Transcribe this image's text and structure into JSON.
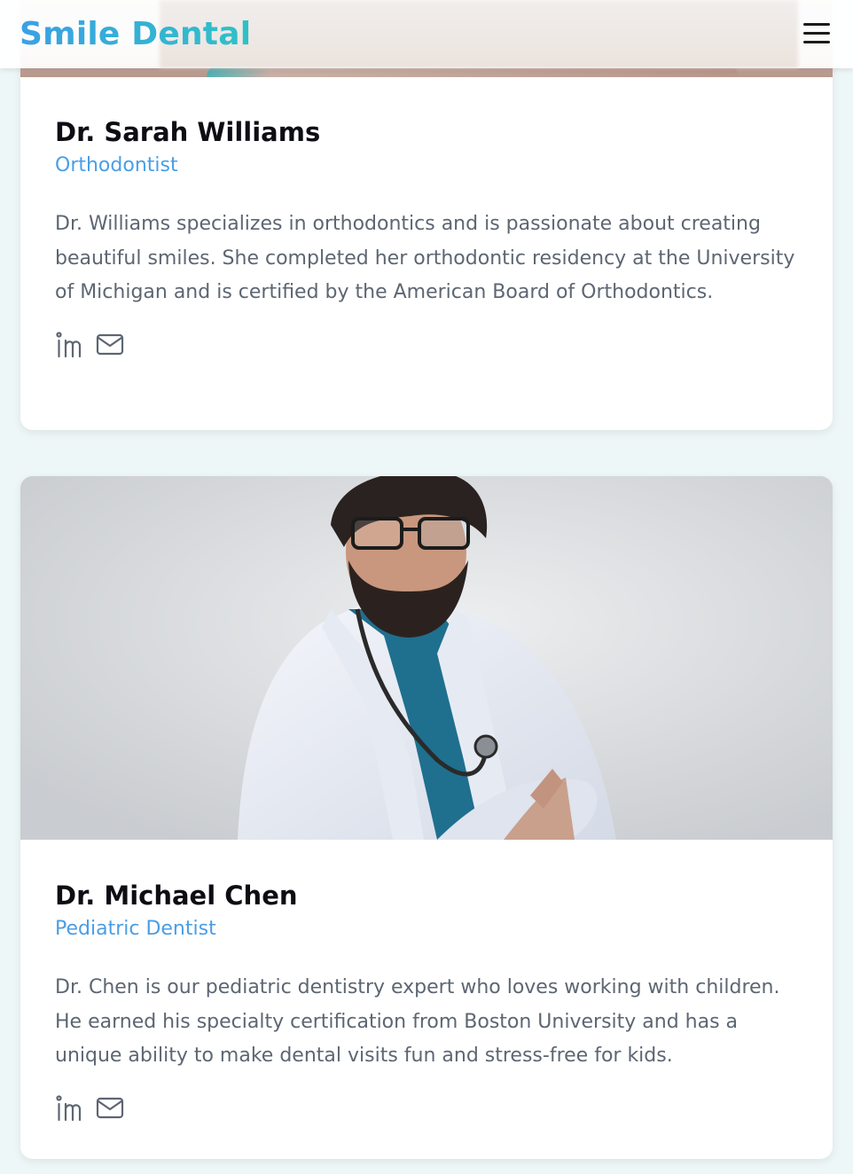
{
  "header": {
    "logo": "Smile Dental",
    "menu_icon": "hamburger-icon"
  },
  "doctors": [
    {
      "name": "Dr. Sarah Williams",
      "role": "Orthodontist",
      "bio": "Dr. Williams specializes in orthodontics and is passionate about creating beautiful smiles. She completed her orthodontic residency at the University of Michigan and is certified by the American Board of Orthodontics.",
      "social_icons": [
        "linkedin-icon",
        "mail-icon"
      ]
    },
    {
      "name": "Dr. Michael Chen",
      "role": "Pediatric Dentist",
      "bio": "Dr. Chen is our pediatric dentistry expert who loves working with children. He earned his specialty certification from Boston University and has a unique ability to make dental visits fun and stress-free for kids.",
      "social_icons": [
        "linkedin-icon",
        "mail-icon"
      ]
    }
  ],
  "colors": {
    "accent": "#4a9ee5",
    "logo_gradient_start": "#3aa0e6",
    "logo_gradient_end": "#2fc1c6",
    "background": "#eef7f7"
  }
}
